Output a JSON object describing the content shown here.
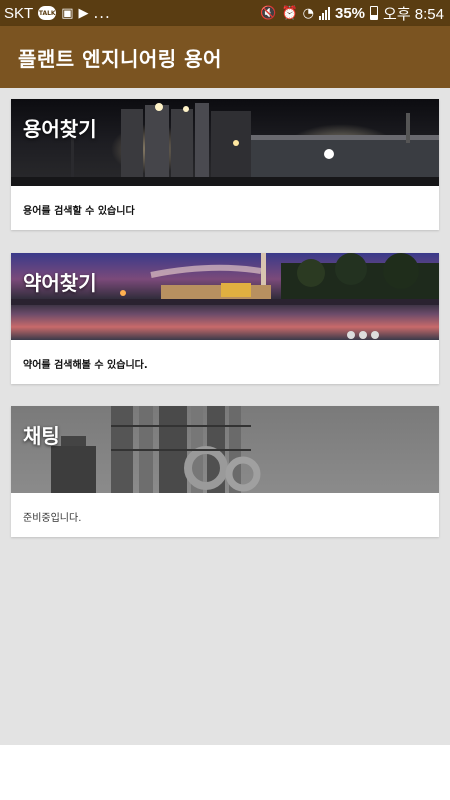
{
  "status_bar": {
    "carrier": "SKT",
    "talk_badge": "TALK",
    "more": "...",
    "battery": "35%",
    "time": "오후 8:54"
  },
  "app_bar": {
    "title": "플랜트 엔지니어링 용어"
  },
  "cards": [
    {
      "title": "용어찾기",
      "description": "용어를 검색할 수 있습니다"
    },
    {
      "title": "약어찾기",
      "description": "약어를 검색해볼 수 있습니다."
    },
    {
      "title": "채팅",
      "description": "준비중입니다."
    }
  ],
  "colors": {
    "status_bar": "#5a3d12",
    "app_bar": "#7b5421",
    "content_bg": "#e3e3e3"
  }
}
